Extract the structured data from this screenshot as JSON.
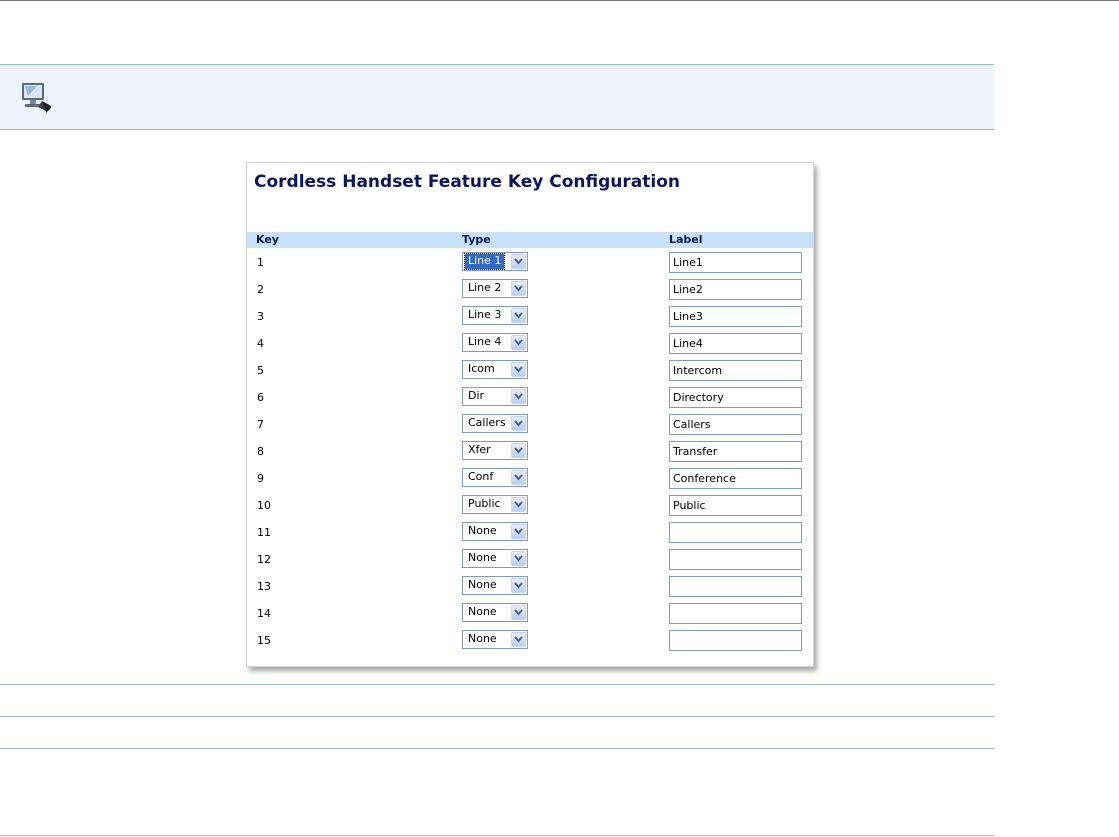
{
  "panel": {
    "title": "Cordless Handset Feature Key Configuration",
    "headers": {
      "key": "Key",
      "type": "Type",
      "label": "Label"
    }
  },
  "rows": [
    {
      "key": "1",
      "type": "Line 1",
      "label": "Line1",
      "highlighted": true
    },
    {
      "key": "2",
      "type": "Line 2",
      "label": "Line2"
    },
    {
      "key": "3",
      "type": "Line 3",
      "label": "Line3"
    },
    {
      "key": "4",
      "type": "Line 4",
      "label": "Line4"
    },
    {
      "key": "5",
      "type": "Icom",
      "label": "Intercom"
    },
    {
      "key": "6",
      "type": "Dir",
      "label": "Directory"
    },
    {
      "key": "7",
      "type": "Callers",
      "label": "Callers"
    },
    {
      "key": "8",
      "type": "Xfer",
      "label": "Transfer"
    },
    {
      "key": "9",
      "type": "Conf",
      "label": "Conference"
    },
    {
      "key": "10",
      "type": "Public",
      "label": "Public"
    },
    {
      "key": "11",
      "type": "None",
      "label": ""
    },
    {
      "key": "12",
      "type": "None",
      "label": ""
    },
    {
      "key": "13",
      "type": "None",
      "label": ""
    },
    {
      "key": "14",
      "type": "None",
      "label": ""
    },
    {
      "key": "15",
      "type": "None",
      "label": ""
    }
  ],
  "icons": {
    "band": "computer-icon",
    "dropdown": "chevron-down-icon"
  },
  "colors": {
    "title": "#0a1560",
    "header_bg": "#c9e1f9",
    "band_bg": "#eef3fb",
    "rule": "#9eb8d8",
    "selection": "#316ac5"
  }
}
